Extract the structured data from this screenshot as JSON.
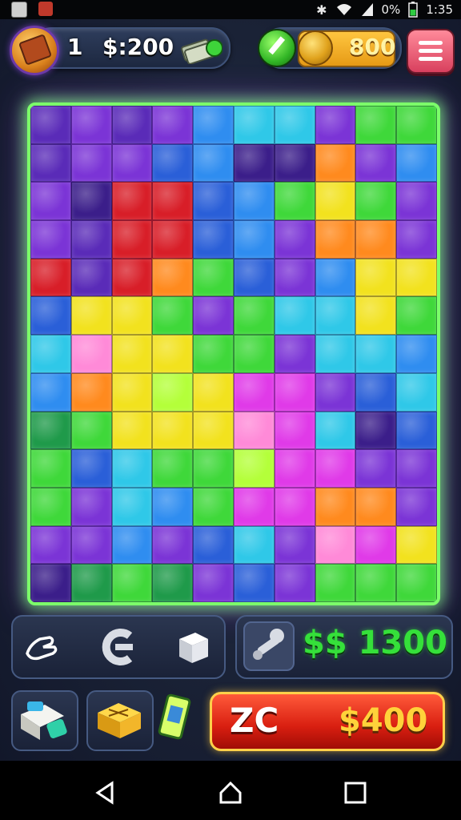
{
  "status_bar": {
    "battery_text": "0%",
    "time": "1:35",
    "icons": [
      "photo-icon",
      "app-icon",
      "vibrate-icon",
      "wifi-icon",
      "signal-icon",
      "battery-icon"
    ]
  },
  "hud": {
    "level": "1",
    "money": "$:200",
    "coins": "800",
    "icons": [
      "profile-icon",
      "cash-stack-icon",
      "pencil-icon",
      "coin-icon",
      "menu-icon"
    ]
  },
  "board": {
    "columns": 10,
    "rows": 13,
    "palette": {
      "P": "#7b34d6",
      "p": "#5a2bb8",
      "D": "#3b1e8a",
      "B": "#2f8df0",
      "b": "#2a5fd8",
      "C": "#2fc8e8",
      "G": "#3fd83a",
      "g": "#1f9a4a",
      "Y": "#f2e21e",
      "O": "#ff8a1e",
      "R": "#d81e28",
      "M": "#e03ae8",
      "K": "#ff8ad8",
      "L": "#b4ff3a"
    },
    "cells": [
      "pPpPBCCPGG",
      "pPPbBDDOPB",
      "PDRRbBGYGP",
      "PpRRbBPOOP",
      "RpROGbPBYY",
      "bYYGPGCCYG",
      "CKYYGGPCCB",
      "BOYLYMMPbC",
      "gGYYYKMCDb",
      "GbCGGLMMPP",
      "GPCBGMMOOP",
      "PPBPbCPKMY",
      "DgGgPbPGGG"
    ]
  },
  "tools": {
    "icons": [
      "hand-icon",
      "magnet-icon",
      "block-icon",
      "wrench-icon"
    ],
    "cash": "$$ 1300"
  },
  "shop": {
    "icons": [
      "piece-pack-icon",
      "gold-box-icon",
      "card-icon"
    ],
    "buy_label": "ZC",
    "buy_price": "$400"
  },
  "nav": {
    "icons": [
      "back-icon",
      "home-icon",
      "recents-icon"
    ]
  }
}
